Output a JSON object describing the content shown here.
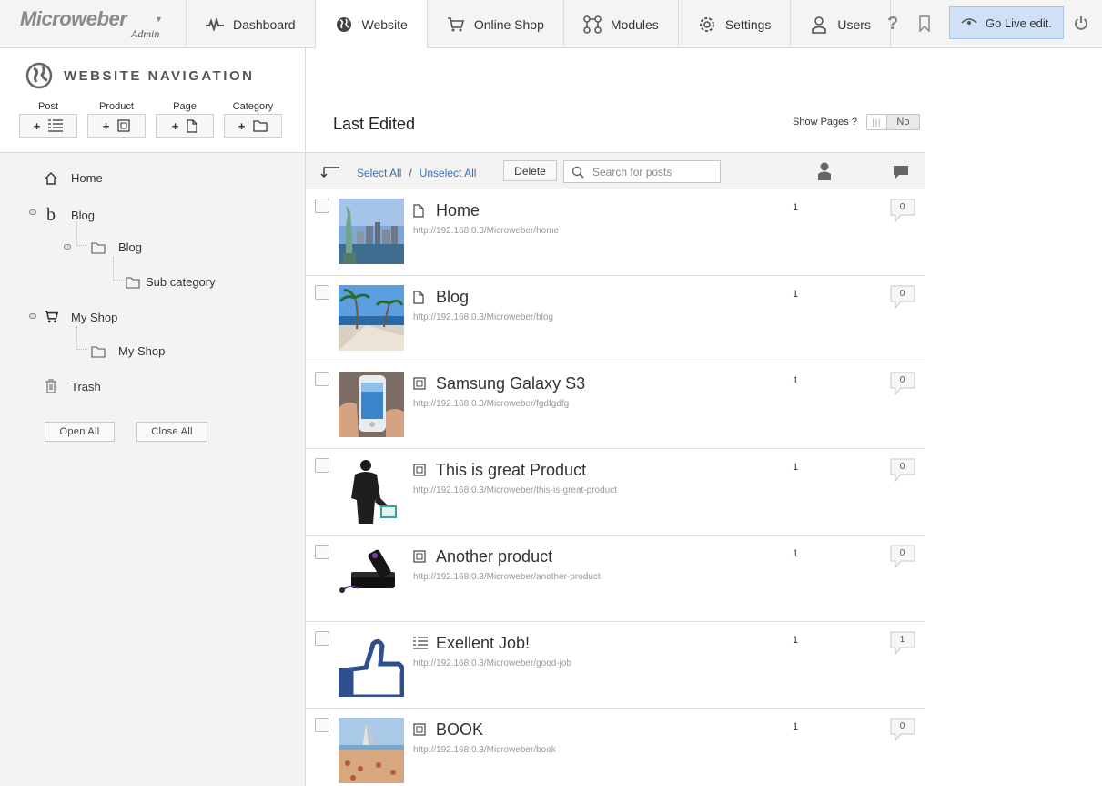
{
  "brand": {
    "name": "Microweber",
    "sub": "Admin"
  },
  "nav": {
    "dashboard": "Dashboard",
    "website": "Website",
    "shop": "Online Shop",
    "modules": "Modules",
    "settings": "Settings",
    "users": "Users"
  },
  "help_label": "?",
  "golive_label": "Go Live edit.",
  "sidebar": {
    "title": "WEBSITE NAVIGATION",
    "add": {
      "post": "Post",
      "product": "Product",
      "page": "Page",
      "category": "Category",
      "plus": "+"
    },
    "tree": {
      "home": "Home",
      "blog": "Blog",
      "blog_cat": "Blog",
      "sub_cat": "Sub category",
      "shop": "My Shop",
      "shop_cat": "My Shop",
      "trash": "Trash"
    },
    "open_all": "Open All",
    "close_all": "Close All"
  },
  "main": {
    "title": "Last Edited",
    "show_pages_label": "Show Pages ?",
    "show_pages_value": "No",
    "toolbar": {
      "select_all": "Select All",
      "separator": "/",
      "unselect_all": "Unselect All",
      "delete": "Delete",
      "search_placeholder": "Search for posts"
    },
    "rows": [
      {
        "title": "Home",
        "type": "page",
        "url": "http://192.168.0.3/Microweber/home",
        "author": "1",
        "comments": "0"
      },
      {
        "title": "Blog",
        "type": "page",
        "url": "http://192.168.0.3/Microweber/blog",
        "author": "1",
        "comments": "0"
      },
      {
        "title": "Samsung Galaxy S3",
        "type": "product",
        "url": "http://192.168.0.3/Microweber/fgdfgdfg",
        "author": "1",
        "comments": "0"
      },
      {
        "title": "This is great Product",
        "type": "product",
        "url": "http://192.168.0.3/Microweber/this-is-great-product",
        "author": "1",
        "comments": "0"
      },
      {
        "title": "Another product",
        "type": "product",
        "url": "http://192.168.0.3/Microweber/another-product",
        "author": "1",
        "comments": "0"
      },
      {
        "title": "Exellent Job!",
        "type": "post",
        "url": "http://192.168.0.3/Microweber/good-job",
        "author": "1",
        "comments": "1"
      },
      {
        "title": "BOOK",
        "type": "product",
        "url": "http://192.168.0.3/Microweber/book",
        "author": "1",
        "comments": "0"
      }
    ]
  },
  "colors": {
    "accent_link": "#3a6fb0",
    "golive_bg": "#cfe0f7",
    "sidebar_bg": "#f3f3f3"
  }
}
